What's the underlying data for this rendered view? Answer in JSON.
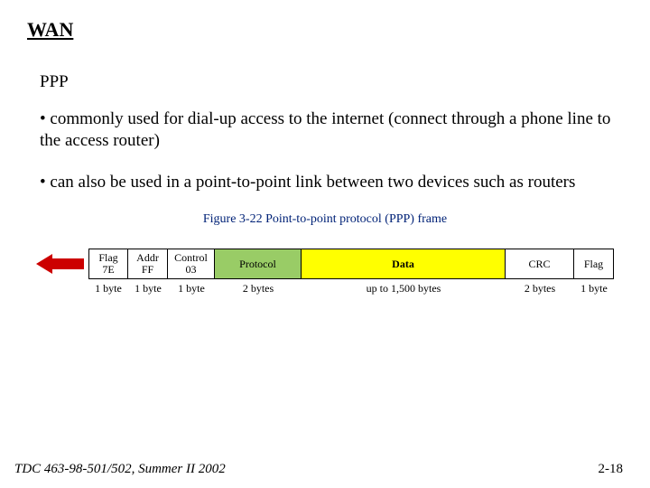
{
  "title": "WAN",
  "subtitle": "PPP",
  "bullets": [
    "• commonly used for dial-up access to the internet (connect through a phone line to the access router)",
    "• can also be used in a point-to-point link between two devices such as routers"
  ],
  "figure": {
    "caption": "Figure  3-22   Point-to-point protocol (PPP) frame",
    "fields": [
      {
        "line1": "Flag",
        "line2": "7E",
        "size": "1 byte"
      },
      {
        "line1": "Addr",
        "line2": "FF",
        "size": "1 byte"
      },
      {
        "line1": "Control",
        "line2": "03",
        "size": "1 byte"
      },
      {
        "line1": "Protocol",
        "line2": "",
        "size": "2 bytes"
      },
      {
        "line1": "Data",
        "line2": "",
        "size": "up to 1,500 bytes"
      },
      {
        "line1": "CRC",
        "line2": "",
        "size": "2 bytes"
      },
      {
        "line1": "Flag",
        "line2": "",
        "size": "1 byte"
      }
    ]
  },
  "footer": {
    "left": "TDC 463-98-501/502, Summer II 2002",
    "right": "2-18"
  }
}
